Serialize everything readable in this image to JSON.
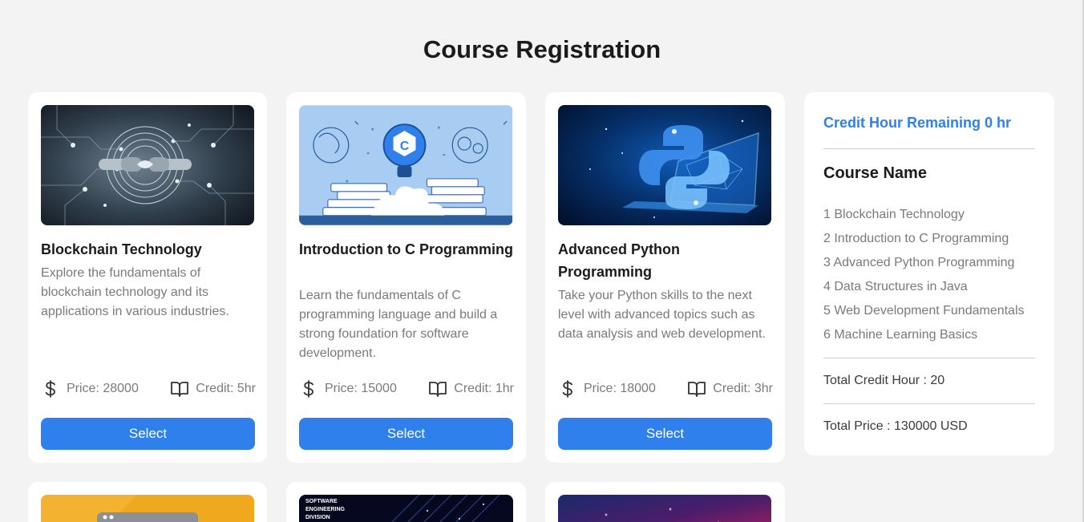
{
  "page": {
    "title": "Course Registration"
  },
  "courses": [
    {
      "title": "Blockchain Technology",
      "description": "Explore the fundamentals of blockchain technology and its applications in various industries.",
      "price": "Price: 28000",
      "credit": "Credit: 5hr",
      "button": "Select"
    },
    {
      "title": "Introduction to C Programming",
      "description": "Learn the fundamentals of C programming language and build a strong foundation for software development.",
      "price": "Price: 15000",
      "credit": "Credit: 1hr",
      "button": "Select"
    },
    {
      "title": "Advanced Python Programming",
      "description": "Take your Python skills to the next level with advanced topics such as data analysis and web development.",
      "price": "Price: 18000",
      "credit": "Credit: 3hr",
      "button": "Select"
    },
    {
      "image_text": "SOFTWARE ENGINEERING DIVISION"
    }
  ],
  "cart": {
    "remaining": "Credit Hour Remaining 0 hr",
    "heading": "Course Name",
    "items": [
      "1 Blockchain Technology",
      "2 Introduction to C Programming",
      "3 Advanced Python Programming",
      "4 Data Structures in Java",
      "5 Web Development Fundamentals",
      "6 Machine Learning Basics"
    ],
    "total_credit": "Total Credit Hour : 20",
    "total_price": "Total Price : 130000 USD"
  },
  "colors": {
    "accent": "#2f80ed",
    "background": "#f3f3f3",
    "card": "#ffffff",
    "muted_text": "#7a7a7a"
  },
  "icons": [
    "dollar-icon",
    "book-icon"
  ]
}
